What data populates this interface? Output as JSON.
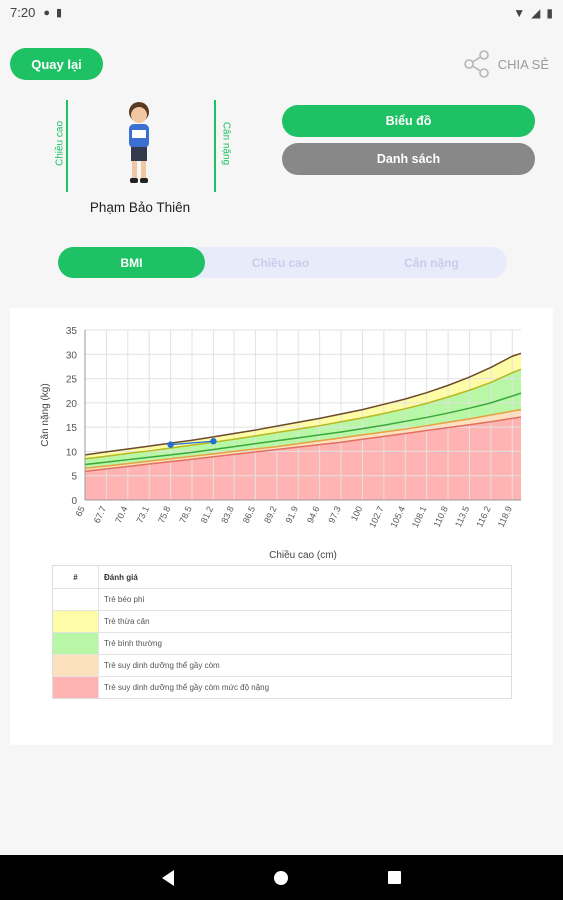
{
  "status": {
    "time": "7:20"
  },
  "header": {
    "back_label": "Quay lại",
    "share_label": "CHIA SẺ"
  },
  "profile": {
    "name": "Phạm Bảo Thiên",
    "height_label": "Chiều cao",
    "weight_label": "Cân nặng"
  },
  "actions": {
    "chart_label": "Biểu đồ",
    "list_label": "Danh sách"
  },
  "tabs": [
    {
      "label": "BMI",
      "active": true
    },
    {
      "label": "Chiều cao",
      "active": false
    },
    {
      "label": "Cân nặng",
      "active": false
    }
  ],
  "colors": {
    "accent": "#1ec163",
    "grey_button": "#888888",
    "obese": "#ffffff",
    "overweight": "#fffca8",
    "normal": "#b7f7a6",
    "thin": "#fde0bd",
    "severe_thin": "#ffb3b3",
    "point": "#1e6fd9"
  },
  "chart_data": {
    "type": "area",
    "xlabel": "Chiều cao (cm)",
    "ylabel": "Cân nặng (kg)",
    "ylim": [
      0,
      35
    ],
    "yticks": [
      0,
      5,
      10,
      15,
      20,
      25,
      30,
      35
    ],
    "x_tick_labels": [
      "65",
      "67.7",
      "70.4",
      "73.1",
      "75.8",
      "78.5",
      "81.2",
      "83.8",
      "86.5",
      "89.2",
      "91.9",
      "94.6",
      "97.3",
      "100",
      "102.7",
      "105.4",
      "108.1",
      "110.8",
      "113.5",
      "116.2",
      "118.9"
    ],
    "x": [
      65,
      67.7,
      70.4,
      73.1,
      75.8,
      78.5,
      81.2,
      83.8,
      86.5,
      89.2,
      91.9,
      94.6,
      97.3,
      100,
      102.7,
      105.4,
      108.1,
      110.8,
      113.5,
      116.2,
      118.9,
      120
    ],
    "curves": {
      "minus3sd": [
        5.9,
        6.4,
        6.9,
        7.4,
        7.9,
        8.4,
        8.9,
        9.4,
        9.9,
        10.4,
        10.9,
        11.4,
        11.9,
        12.5,
        13.1,
        13.7,
        14.3,
        14.9,
        15.5,
        16.1,
        16.8,
        17.1
      ],
      "minus2sd": [
        6.5,
        7.0,
        7.5,
        8.0,
        8.5,
        9.0,
        9.5,
        10.0,
        10.5,
        11.0,
        11.6,
        12.2,
        12.8,
        13.4,
        14.0,
        14.6,
        15.3,
        16.0,
        16.7,
        17.5,
        18.3,
        18.6
      ],
      "median": [
        7.3,
        7.8,
        8.3,
        8.8,
        9.3,
        9.8,
        10.4,
        11.0,
        11.6,
        12.2,
        12.8,
        13.4,
        14.0,
        14.7,
        15.4,
        16.2,
        17.0,
        17.9,
        18.9,
        20.0,
        21.4,
        22.0
      ],
      "plus2sd": [
        8.5,
        9.0,
        9.6,
        10.1,
        10.7,
        11.3,
        11.9,
        12.5,
        13.2,
        13.9,
        14.6,
        15.3,
        16.1,
        16.9,
        17.8,
        18.8,
        19.9,
        21.2,
        22.6,
        24.2,
        26.2,
        26.9
      ],
      "plus3sd": [
        9.3,
        9.9,
        10.5,
        11.1,
        11.7,
        12.3,
        13.0,
        13.7,
        14.4,
        15.2,
        16.0,
        16.8,
        17.7,
        18.6,
        19.7,
        20.8,
        22.1,
        23.6,
        25.3,
        27.3,
        29.6,
        30.2
      ]
    },
    "bands": [
      "obese",
      "overweight",
      "normal",
      "thin",
      "severe_thin"
    ],
    "points": [
      {
        "x": 75.8,
        "y": 11.4
      },
      {
        "x": 81.2,
        "y": 12.1
      }
    ],
    "grid": true
  },
  "legend": {
    "header": {
      "index": "#",
      "label": "Đánh giá"
    },
    "rows": [
      {
        "label": "Trẻ béo phì",
        "color_key": "obese"
      },
      {
        "label": "Trẻ thừa cân",
        "color_key": "overweight"
      },
      {
        "label": "Trẻ bình thường",
        "color_key": "normal"
      },
      {
        "label": "Trẻ suy dinh dưỡng thể gầy còm",
        "color_key": "thin"
      },
      {
        "label": "Trẻ suy dinh dưỡng thể gầy còm mức độ nặng",
        "color_key": "severe_thin"
      }
    ]
  }
}
